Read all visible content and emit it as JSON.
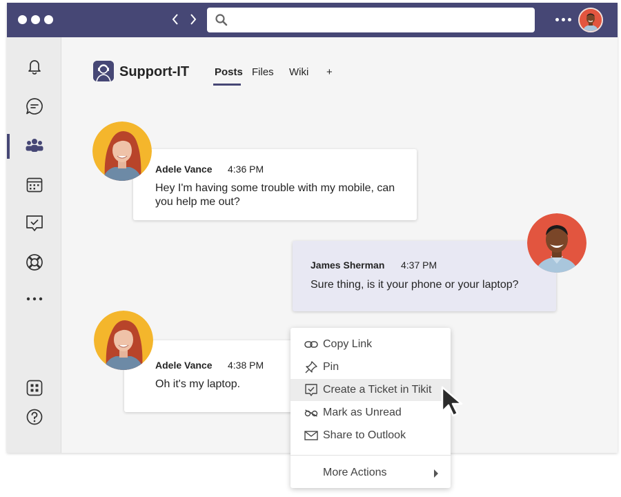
{
  "window": {
    "titlebar_color": "#464775",
    "accent": "#464775"
  },
  "search": {
    "value": "",
    "placeholder": ""
  },
  "rail": {
    "items": [
      {
        "icon": "bell-icon",
        "label": "Activity"
      },
      {
        "icon": "chat-icon",
        "label": "Chat"
      },
      {
        "icon": "teams-icon",
        "label": "Teams",
        "active": true
      },
      {
        "icon": "calendar-icon",
        "label": "Calendar"
      },
      {
        "icon": "tasks-icon",
        "label": "Tasks"
      },
      {
        "icon": "lifebuoy-icon",
        "label": "Support"
      },
      {
        "icon": "more-icon",
        "label": "More"
      },
      {
        "icon": "apps-icon",
        "label": "Apps"
      },
      {
        "icon": "help-icon",
        "label": "Help"
      }
    ]
  },
  "channel": {
    "name": "Support-IT",
    "tabs": [
      {
        "label": "Posts",
        "active": true
      },
      {
        "label": "Files"
      },
      {
        "label": "Wiki"
      },
      {
        "label": "+"
      }
    ]
  },
  "messages": [
    {
      "author": "Adele Vance",
      "time": "4:36 PM",
      "text": "Hey I'm having some trouble with my mobile, can you help me out?"
    },
    {
      "author": "James Sherman",
      "time": "4:37 PM",
      "text": "Sure thing, is it your phone or your laptop?"
    },
    {
      "author": "Adele Vance",
      "time": "4:38 PM",
      "text": "Oh it's my laptop."
    }
  ],
  "context_menu": {
    "items": [
      {
        "icon": "link-icon",
        "label": "Copy Link"
      },
      {
        "icon": "pin-icon",
        "label": "Pin"
      },
      {
        "icon": "ticket-icon",
        "label": "Create a Ticket in Tikit",
        "highlighted": true
      },
      {
        "icon": "glasses-icon",
        "label": "Mark as Unread"
      },
      {
        "icon": "mail-icon",
        "label": "Share to Outlook"
      }
    ],
    "more": "More Actions"
  }
}
